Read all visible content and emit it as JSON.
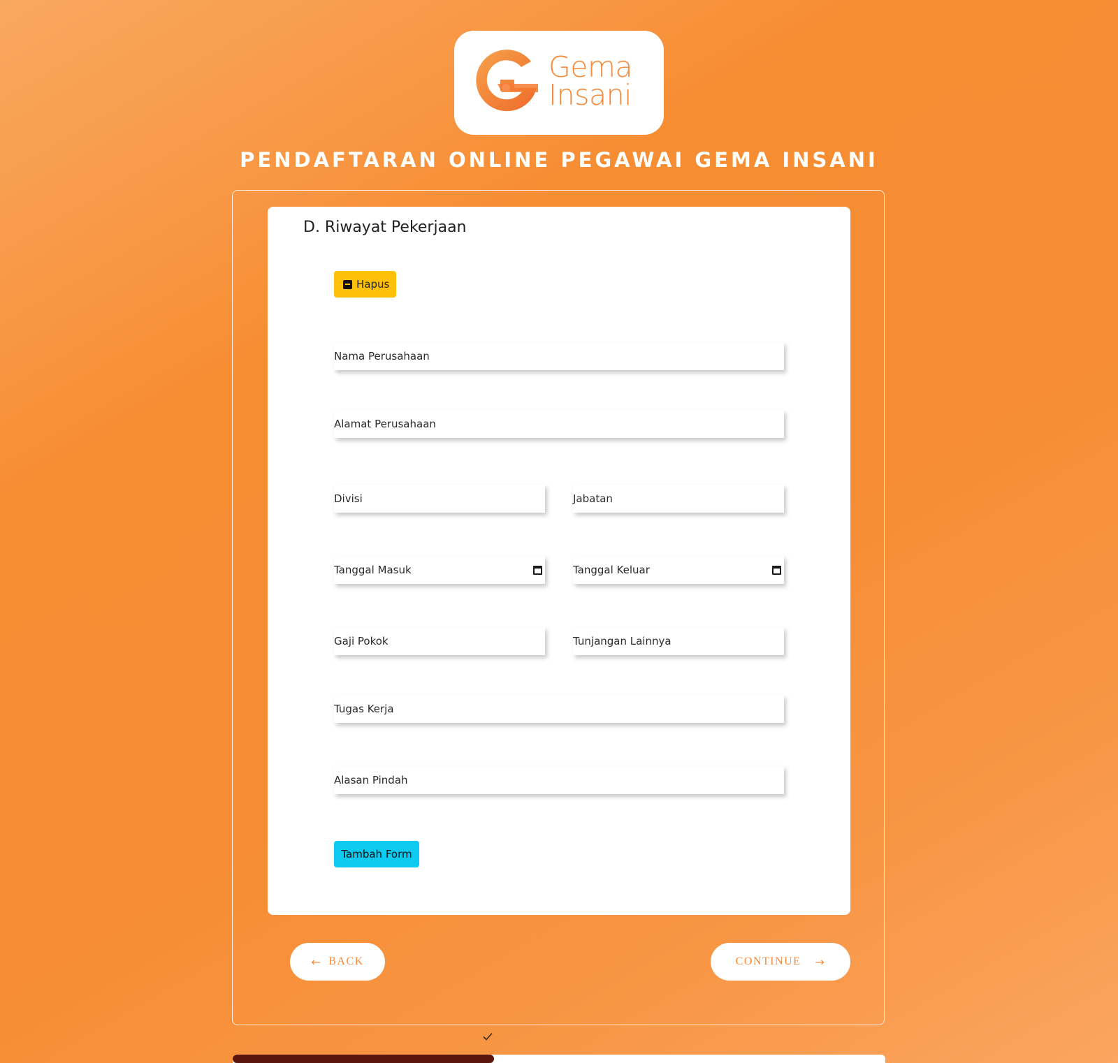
{
  "brand": {
    "line1": "Gema",
    "line2": "Insani",
    "color": "#f58a3a"
  },
  "header": {
    "title": "PENDAFTARAN ONLINE PEGAWAI GEMA INSANI"
  },
  "section": {
    "title": "D. Riwayat Pekerjaan"
  },
  "buttons": {
    "hapus": "Hapus",
    "tambah": "Tambah Form"
  },
  "fields": {
    "nama_perusahaan": "Nama Perusahaan",
    "alamat_perusahaan": "Alamat Perusahaan",
    "divisi": "Divisi",
    "jabatan": "Jabatan",
    "tanggal_masuk": "Tanggal Masuk",
    "tanggal_keluar": "Tanggal Keluar",
    "gaji_pokok": "Gaji Pokok",
    "tunjangan_lainnya": "Tunjangan Lainnya",
    "tugas_kerja": "Tugas Kerja",
    "alasan_pindah": "Alasan Pindah"
  },
  "nav": {
    "back": "BACK",
    "continue": "CONTINUE",
    "back_icon": "arrow-left-icon",
    "continue_icon": "arrow-right-icon"
  },
  "progress": {
    "fraction": 0.4,
    "fill_color": "#5a160c"
  },
  "colors": {
    "warning": "#ffc107",
    "info": "#0dcaf0",
    "accent": "#f68c33"
  }
}
